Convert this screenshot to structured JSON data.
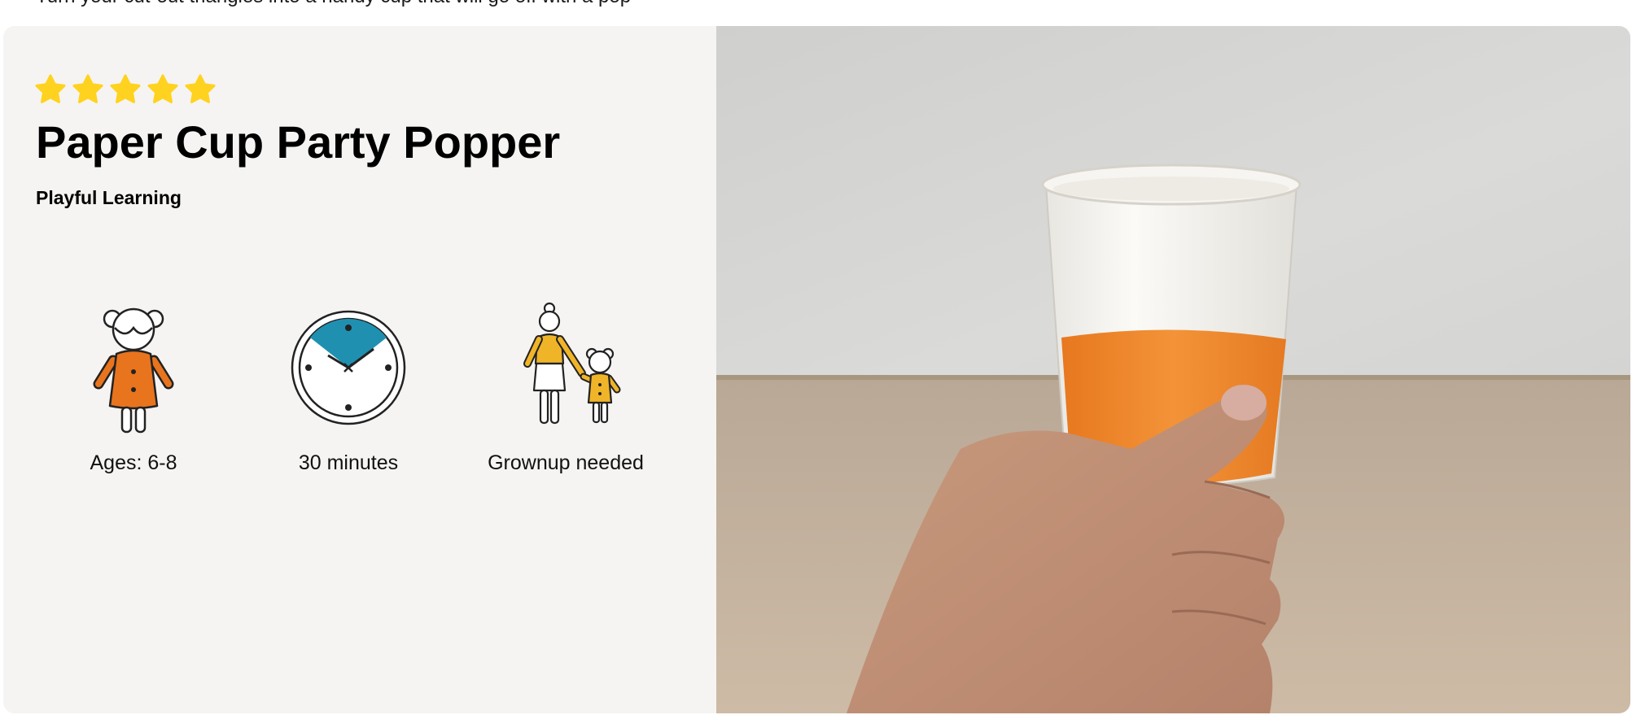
{
  "header": {
    "intro_text": "Turn your cut-out triangles into a handy cup that will go off with a pop"
  },
  "activity": {
    "rating": {
      "value": 5,
      "max": 5,
      "color": "#FFD21F"
    },
    "title": "Paper Cup Party Popper",
    "category": "Playful Learning",
    "features": [
      {
        "icon": "child-icon",
        "label": "Ages: 6-8"
      },
      {
        "icon": "clock-icon",
        "label": "30 minutes"
      },
      {
        "icon": "grownup-with-child-icon",
        "label": "Grownup needed"
      }
    ]
  },
  "colors": {
    "panel_background": "#f5f4f2",
    "child_dress": "#E8741E",
    "clock_wedge": "#2090B0",
    "grownup_shirt": "#F0B429",
    "tape": "#F08A2A"
  }
}
